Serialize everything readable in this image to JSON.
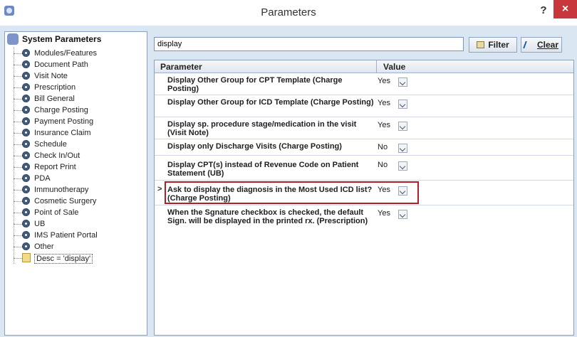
{
  "window": {
    "title": "Parameters",
    "help_label": "?",
    "close_label": "×"
  },
  "tree": {
    "root_label": "System Parameters",
    "items": [
      {
        "label": "Modules/Features"
      },
      {
        "label": "Document Path"
      },
      {
        "label": "Visit Note"
      },
      {
        "label": "Prescription"
      },
      {
        "label": "Bill General"
      },
      {
        "label": "Charge Posting"
      },
      {
        "label": "Payment Posting"
      },
      {
        "label": "Insurance Claim"
      },
      {
        "label": "Schedule"
      },
      {
        "label": "Check In/Out"
      },
      {
        "label": "Report Print"
      },
      {
        "label": "PDA"
      },
      {
        "label": "Immunotherapy"
      },
      {
        "label": "Cosmetic Surgery"
      },
      {
        "label": "Point of Sale"
      },
      {
        "label": "UB"
      },
      {
        "label": "IMS Patient Portal"
      },
      {
        "label": "Other"
      }
    ],
    "filter_node_label": "Desc = 'display'"
  },
  "search": {
    "value": "display"
  },
  "buttons": {
    "filter_label": "Filter",
    "clear_label": "Clear"
  },
  "grid": {
    "columns": [
      "Parameter",
      "Value"
    ],
    "selected_row_index": 5,
    "rows": [
      {
        "parameter": "Display Other Group for CPT Template (Charge Posting)",
        "value": "Yes"
      },
      {
        "parameter": "Display Other Group for ICD Template (Charge Posting)",
        "value": "Yes"
      },
      {
        "parameter": "Display sp. procedure stage/medication in the visit (Visit Note)",
        "value": "Yes"
      },
      {
        "parameter": "Display only Discharge Visits (Charge Posting)",
        "value": "No"
      },
      {
        "parameter": "Display CPT(s) instead of Revenue Code on Patient Statement (UB)",
        "value": "No"
      },
      {
        "parameter": "Ask to display the diagnosis in the Most Used ICD list? (Charge Posting)",
        "value": "Yes"
      },
      {
        "parameter": "When the Sgnature checkbox is checked, the default Sign. will be displayed in the printed rx. (Prescription)",
        "value": "Yes"
      }
    ],
    "row_pointer": ">"
  },
  "colors": {
    "client_bg": "#dbe6f3",
    "highlight": "#b01e2e",
    "close": "#c7373b"
  }
}
